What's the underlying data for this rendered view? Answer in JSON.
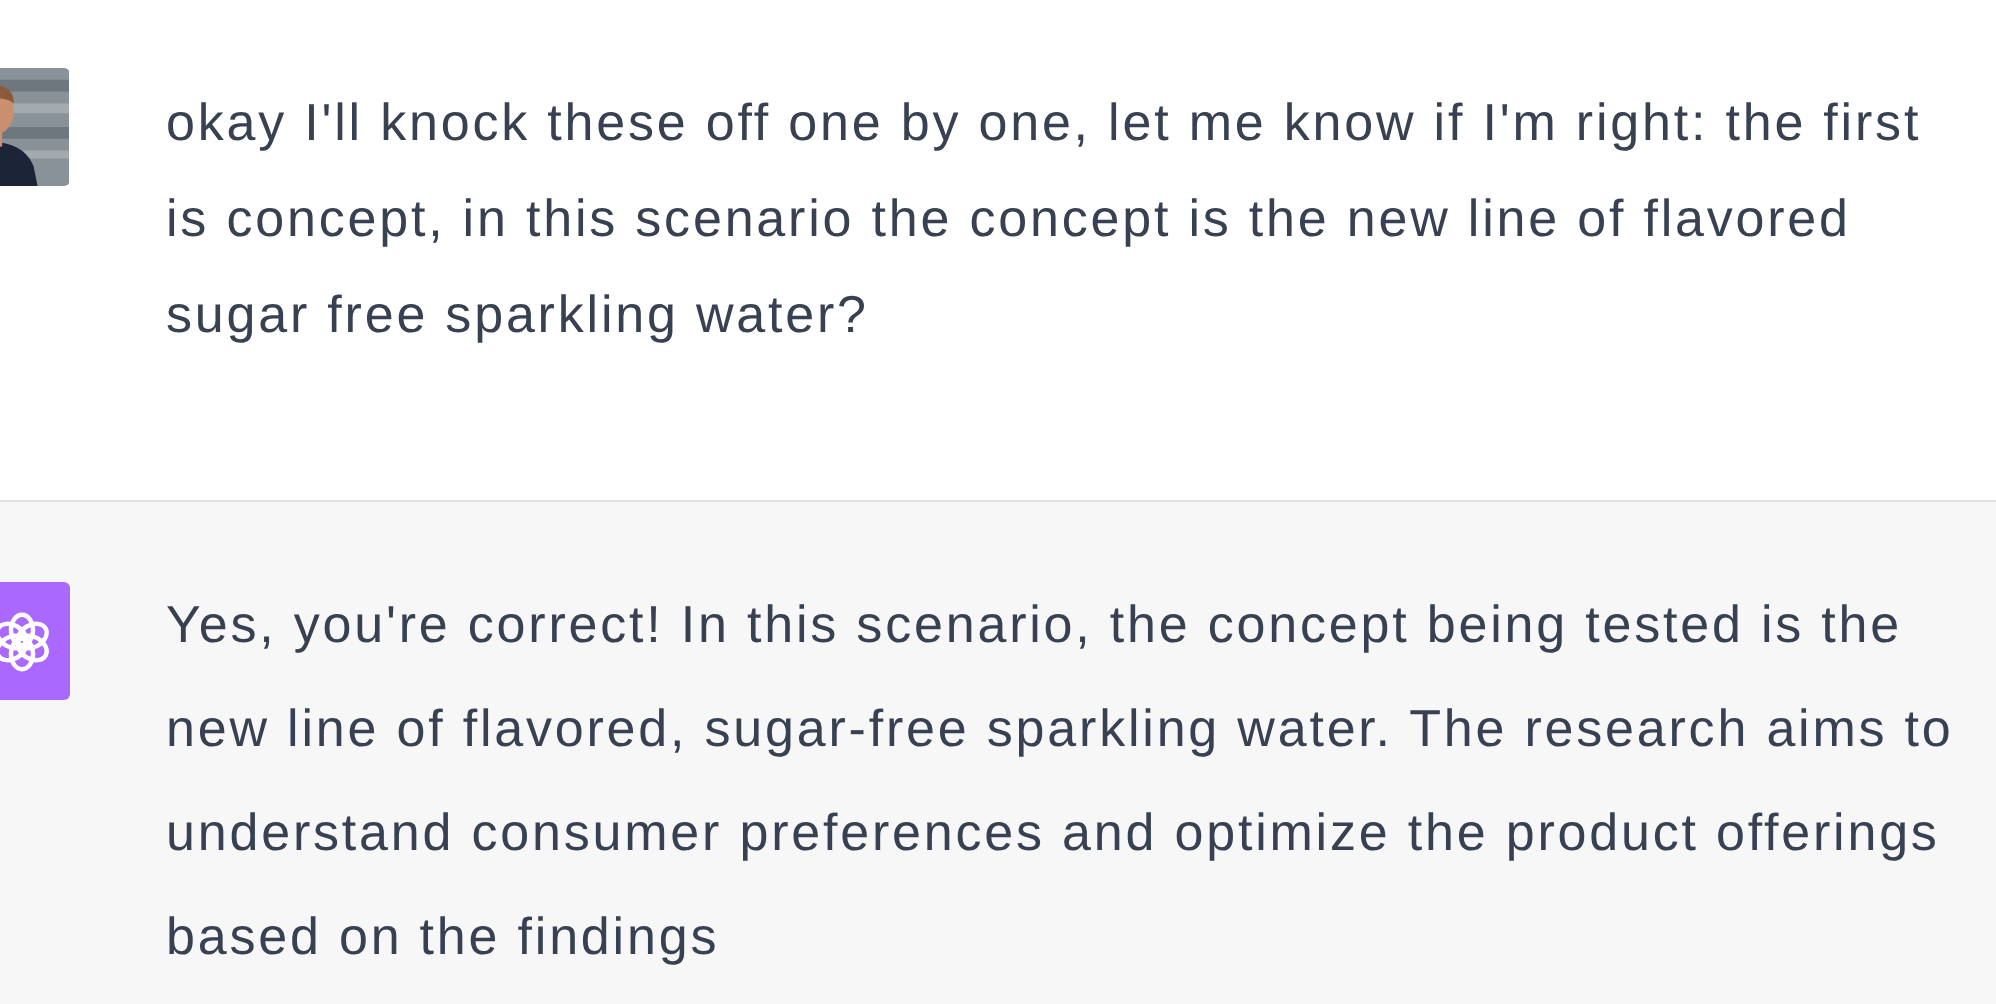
{
  "messages": [
    {
      "text": "okay I'll knock these off one by one, let me know if I'm right: the first is concept, in this scenario the concept is the new line of flavored sugar free sparkling water?"
    },
    {
      "avatar": {
        "kind": "logo"
      },
      "text": "Yes, you're correct! In this scenario, the concept being tested is the new line of flavored, sugar-free sparkling water. The research aims to understand consumer preferences and optimize the product offerings based on the findings"
    }
  ]
}
